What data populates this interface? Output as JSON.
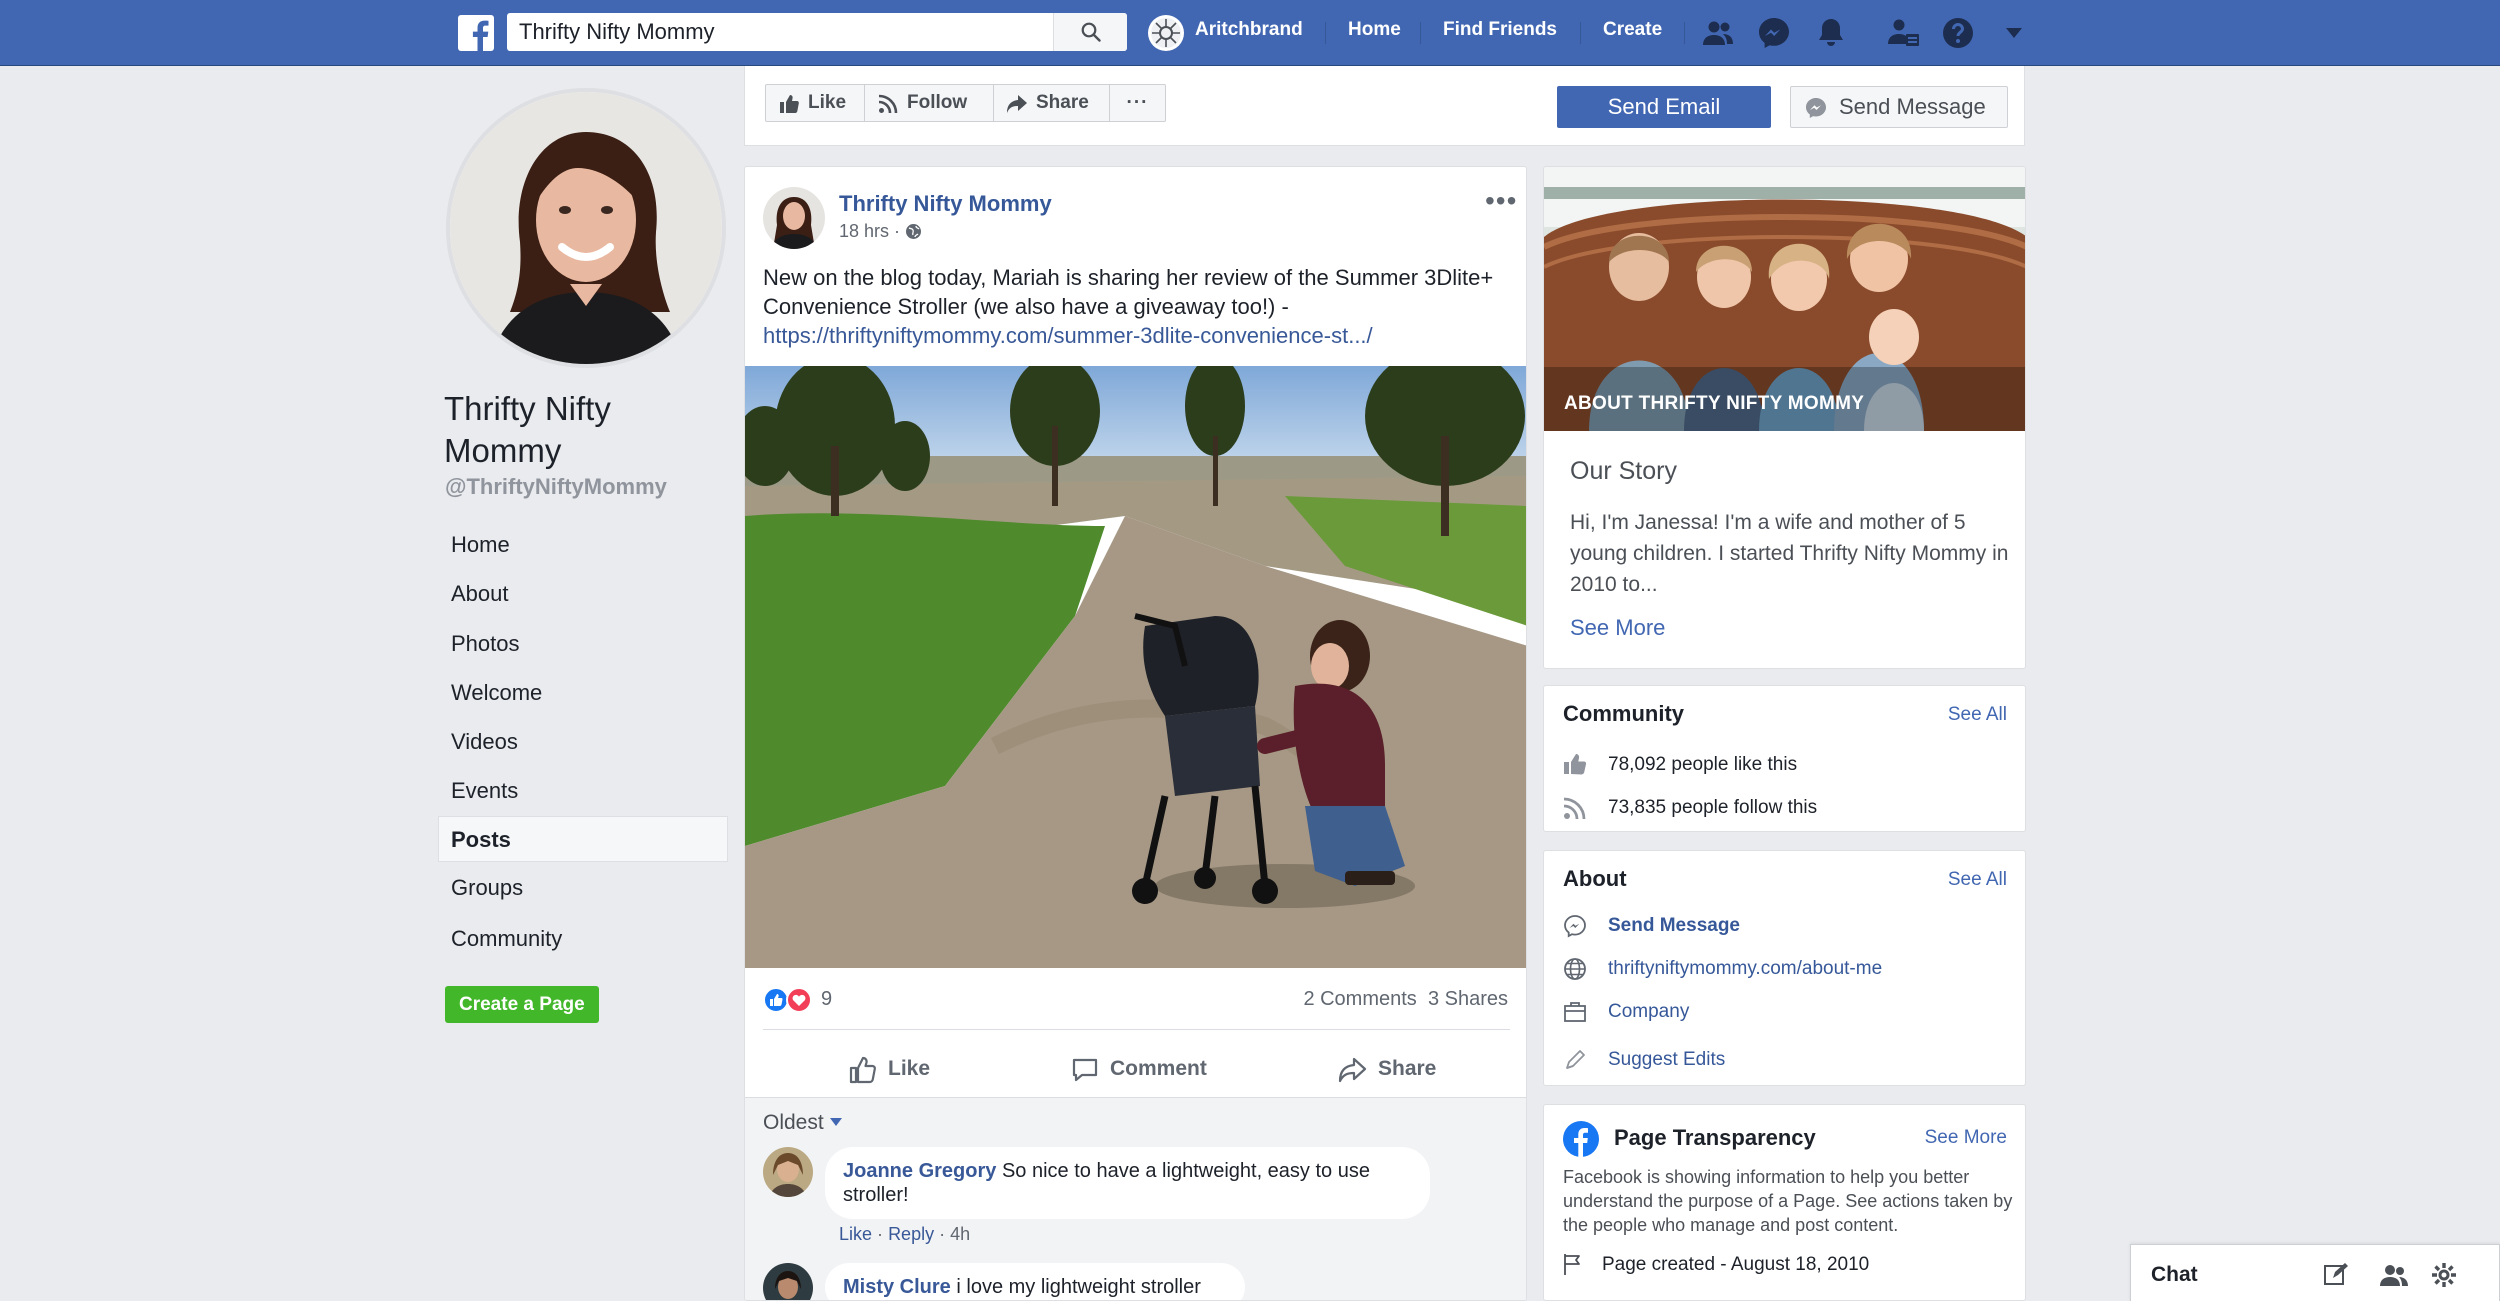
{
  "topbar": {
    "search_value": "Thrifty Nifty Mommy",
    "profile_name": "Aritchbrand",
    "links": [
      "Home",
      "Find Friends",
      "Create"
    ],
    "color": "#4267b2"
  },
  "page": {
    "name": "Thrifty Nifty Mommy",
    "handle": "@ThriftyNiftyMommy",
    "nav": [
      "Home",
      "About",
      "Photos",
      "Welcome",
      "Videos",
      "Events",
      "Posts",
      "Groups",
      "Community"
    ],
    "active_nav": "Posts",
    "create_page_label": "Create a Page"
  },
  "action_bar": {
    "like": "Like",
    "follow": "Follow",
    "share": "Share",
    "more": "···",
    "send_email": "Send Email",
    "send_message": "Send Message"
  },
  "post": {
    "author": "Thrifty Nifty Mommy",
    "time": "18 hrs",
    "time_sep": "·",
    "text": "New on the blog today, Mariah is sharing her review of the Summer 3Dlite+ Convenience Stroller (we also have a giveaway too!) -",
    "link": "https://thriftyniftymommy.com/summer-3dlite-convenience-st.../",
    "reaction_count": "9",
    "comments_count": "2 Comments",
    "shares_count": "3 Shares",
    "actions": {
      "like": "Like",
      "comment": "Comment",
      "share": "Share"
    },
    "sort_label": "Oldest",
    "more": "•••"
  },
  "comments": [
    {
      "name": "Joanne Gregory",
      "text": "So nice to have a lightweight, easy to use stroller!",
      "like": "Like",
      "reply": "Reply",
      "age": "4h",
      "sep": "·"
    },
    {
      "name": "Misty Clure",
      "text": "i love my lightweight stroller"
    }
  ],
  "about_card": {
    "photo_label": "About Thrifty Nifty Mommy",
    "title": "Our Story",
    "text": "Hi, I'm Janessa! I'm a wife and mother of 5 young children. I started Thrifty Nifty Mommy in 2010 to...",
    "see_more": "See More"
  },
  "community": {
    "title": "Community",
    "see_all": "See All",
    "likes": "78,092 people like this",
    "follows": "73,835 people follow this"
  },
  "about": {
    "title": "About",
    "see_all": "See All",
    "send_message": "Send Message",
    "website": "thriftyniftymommy.com/about-me",
    "category": "Company",
    "suggest": "Suggest Edits"
  },
  "transparency": {
    "title": "Page Transparency",
    "see_more": "See More",
    "text": "Facebook is showing information to help you better understand the purpose of a Page. See actions taken by the people who manage and post content.",
    "created": "Page created - August 18, 2010"
  },
  "chat": {
    "label": "Chat"
  }
}
